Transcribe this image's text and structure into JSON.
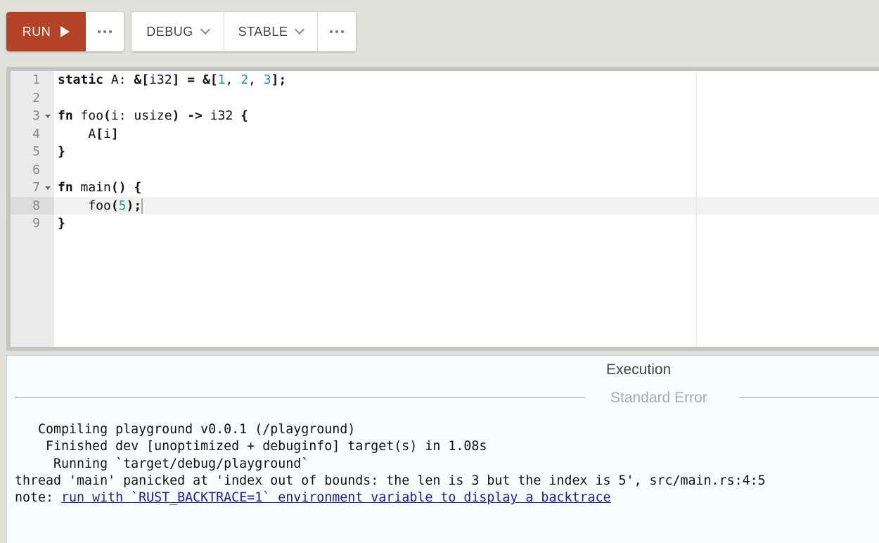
{
  "toolbar": {
    "run_label": "RUN",
    "run_more_label": "···",
    "mode_label": "DEBUG",
    "channel_label": "STABLE",
    "config_more_label": "···",
    "accent_color": "#b44225"
  },
  "editor": {
    "line_numbers": [
      "1",
      "2",
      "3",
      "4",
      "5",
      "6",
      "7",
      "8",
      "9"
    ],
    "active_line": 8,
    "folds": [
      3,
      7
    ],
    "lines": [
      "static A: &[i32] = &[1, 2, 3];",
      "",
      "fn foo(i: usize) -> i32 {",
      "    A[i]",
      "}",
      "",
      "fn main() {",
      "    foo(5);",
      "}"
    ]
  },
  "output": {
    "title": "Execution",
    "section_label": "Standard Error",
    "lines": [
      "   Compiling playground v0.0.1 (/playground)",
      "    Finished dev [unoptimized + debuginfo] target(s) in 1.08s",
      "     Running `target/debug/playground`",
      "thread 'main' panicked at 'index out of bounds: the len is 3 but the index is 5', src/main.rs:4:5"
    ],
    "note_prefix": "note: ",
    "note_link": "run with `RUST_BACKTRACE=1` environment variable to display a backtrace"
  }
}
